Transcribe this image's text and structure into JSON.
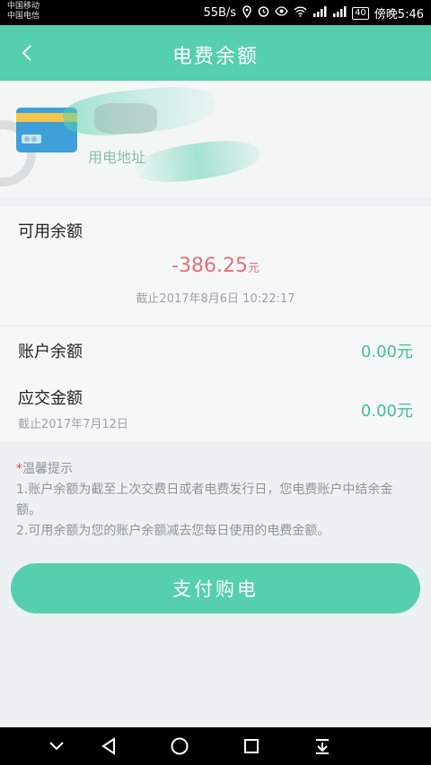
{
  "status_bar": {
    "carrier_line1": "中国移动",
    "carrier_line2": "中国电信",
    "speed": "55B/s",
    "battery": "40",
    "time": "傍晚5:46"
  },
  "header": {
    "title": "电费余额",
    "back_icon": "chevron-left-icon"
  },
  "account": {
    "address_label": "用电地址",
    "card_icon": "bank-card-icon"
  },
  "available": {
    "label": "可用余额",
    "amount": "-386.25",
    "unit": "元",
    "as_of": "截止2017年8月6日  10:22:17"
  },
  "account_balance": {
    "label": "账户余额",
    "value": "0.00元"
  },
  "amount_due": {
    "label": "应交金额",
    "value": "0.00元",
    "as_of": "截止2017年7月12日"
  },
  "tips": {
    "star": "*",
    "title": "温馨提示",
    "line1": "1.账户余额为截至上次交费日或者电费发行日，您电费账户中结余金额。",
    "line2": "2.可用余额为您的账户余额减去您每日使用的电费金额。"
  },
  "pay_button": "支付购电",
  "colors": {
    "accent": "#55cfad",
    "negative": "#e66d77",
    "positive": "#3fbf9e"
  }
}
